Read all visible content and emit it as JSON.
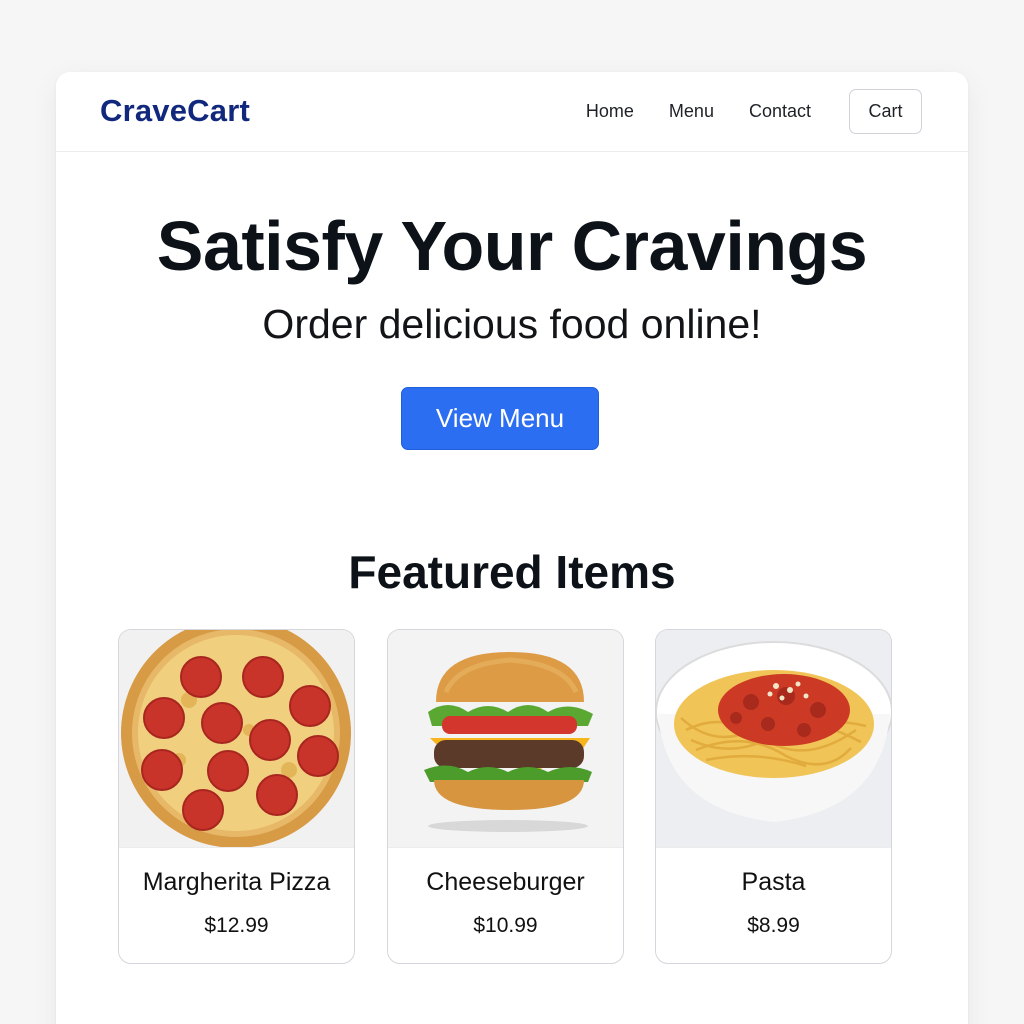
{
  "brand": "CraveCart",
  "nav": {
    "links": [
      "Home",
      "Menu",
      "Contact"
    ],
    "cart_label": "Cart"
  },
  "hero": {
    "title": "Satisfy Your Cravings",
    "subtitle": "Order delicious food online!",
    "cta_label": "View Menu"
  },
  "featured": {
    "heading": "Featured Items",
    "items": [
      {
        "name": "Margherita Pizza",
        "price": "$12.99",
        "image": "pizza-image"
      },
      {
        "name": "Cheeseburger",
        "price": "$10.99",
        "image": "cheeseburger-image"
      },
      {
        "name": "Pasta",
        "price": "$8.99",
        "image": "pasta-image"
      }
    ]
  },
  "colors": {
    "brand": "#12287d",
    "accent": "#2c6ef2",
    "text": "#0c1217"
  }
}
